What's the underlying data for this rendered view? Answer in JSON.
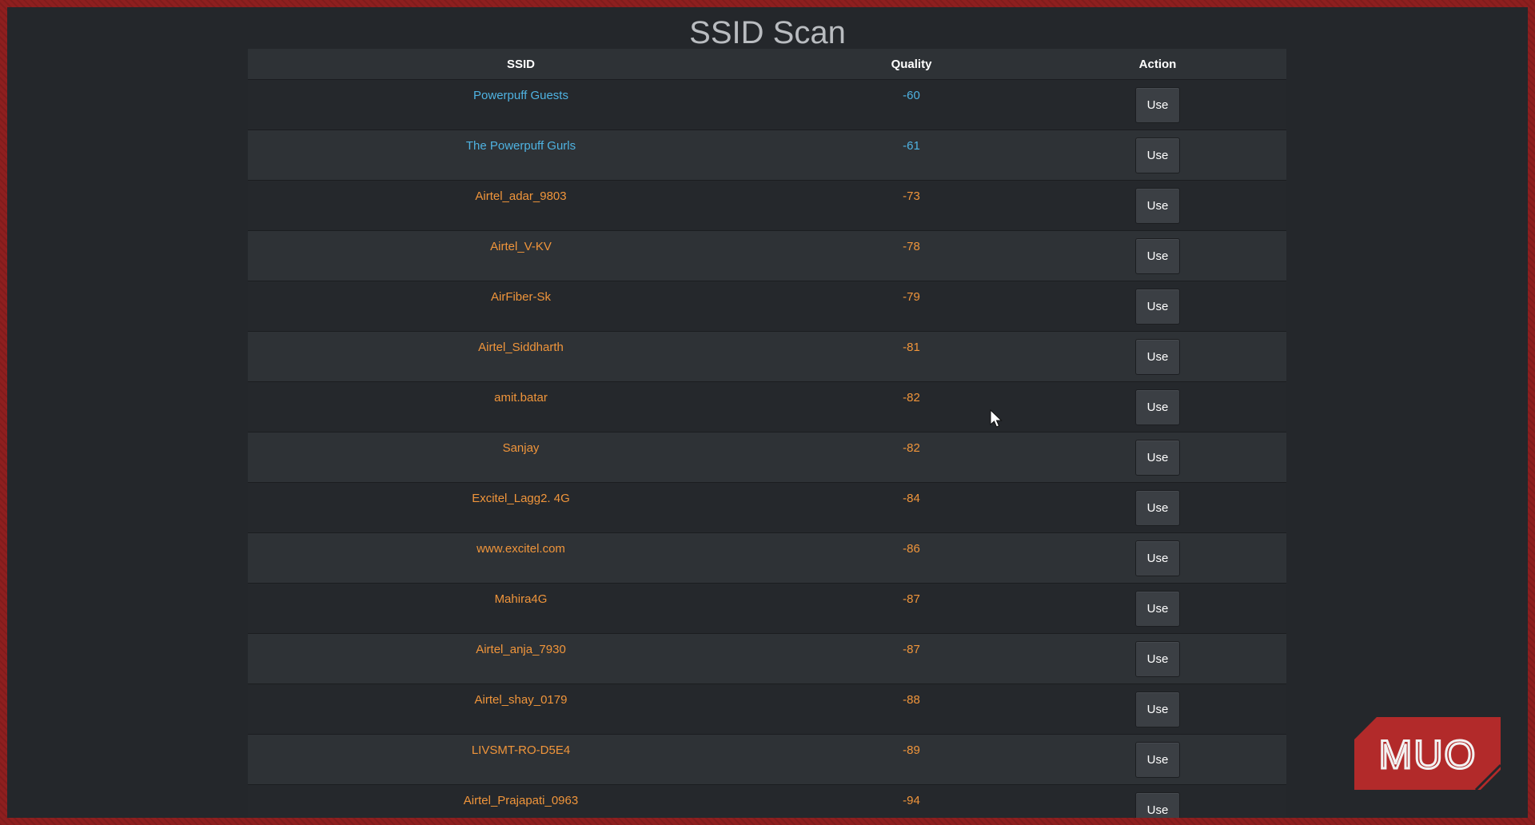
{
  "page": {
    "title": "SSID Scan"
  },
  "table": {
    "columns": [
      "SSID",
      "Quality",
      "Action"
    ],
    "rows": [
      {
        "ssid": "Powerpuff Guests",
        "quality": "-60",
        "action": "Use"
      },
      {
        "ssid": "The Powerpuff Gurls",
        "quality": "-61",
        "action": "Use"
      },
      {
        "ssid": "Airtel_adar_9803",
        "quality": "-73",
        "action": "Use"
      },
      {
        "ssid": "Airtel_V-KV",
        "quality": "-78",
        "action": "Use"
      },
      {
        "ssid": "AirFiber-Sk",
        "quality": "-79",
        "action": "Use"
      },
      {
        "ssid": "Airtel_Siddharth",
        "quality": "-81",
        "action": "Use"
      },
      {
        "ssid": "amit.batar",
        "quality": "-82",
        "action": "Use"
      },
      {
        "ssid": "Sanjay",
        "quality": "-82",
        "action": "Use"
      },
      {
        "ssid": "Excitel_Lagg2. 4G",
        "quality": "-84",
        "action": "Use"
      },
      {
        "ssid": "www.excitel.com",
        "quality": "-86",
        "action": "Use"
      },
      {
        "ssid": "Mahira4G",
        "quality": "-87",
        "action": "Use"
      },
      {
        "ssid": "Airtel_anja_7930",
        "quality": "-87",
        "action": "Use"
      },
      {
        "ssid": "Airtel_shay_0179",
        "quality": "-88",
        "action": "Use"
      },
      {
        "ssid": "LIVSMT-RO-D5E4",
        "quality": "-89",
        "action": "Use"
      },
      {
        "ssid": "Airtel_Prajapati_0963",
        "quality": "-94",
        "action": "Use"
      }
    ]
  },
  "colors": {
    "page_background": "#24272b",
    "border": "#8e1f1f",
    "header_background": "#2e3236",
    "row_even": "#2e3236",
    "row_odd": "#25282c",
    "connected_text": "#4fb3e2",
    "network_text": "#f0953b",
    "button_background": "#3b3f44",
    "logo_red": "#b22a2a"
  },
  "icons": {
    "cursor": "mouse-pointer-icon",
    "logo": "muo-logo"
  },
  "watermark": {
    "text": "MUO"
  }
}
